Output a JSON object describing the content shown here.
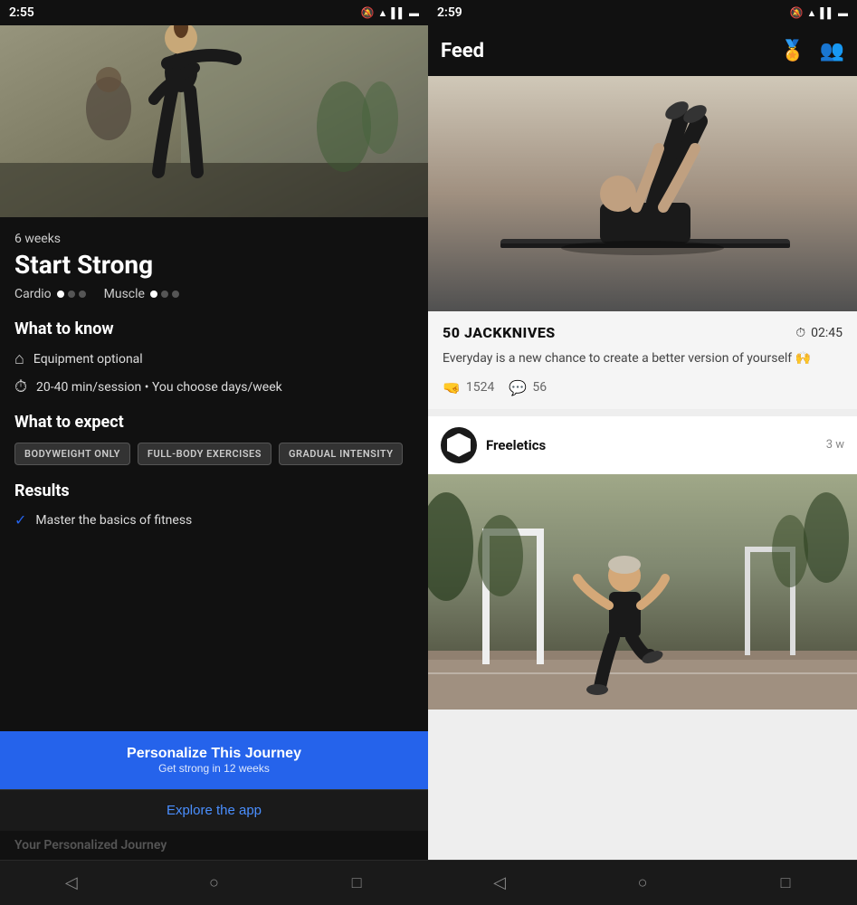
{
  "left": {
    "statusBar": {
      "time": "2:55",
      "icons": [
        "🔔",
        "📶",
        "🔋"
      ]
    },
    "program": {
      "weeks": "6 weeks",
      "title": "Start Strong",
      "cardio": "Cardio",
      "muscle": "Muscle",
      "cardioDots": [
        1,
        0,
        0
      ],
      "muscleDots": [
        1,
        0,
        0
      ]
    },
    "whatToKnow": {
      "sectionTitle": "What to know",
      "equipment": "Equipment optional",
      "duration": "20-40 min/session • You choose days/week"
    },
    "whatToExpect": {
      "sectionTitle": "What to expect",
      "tags": [
        "BODYWEIGHT ONLY",
        "FULL-BODY EXERCISES",
        "GRADUAL INTENSITY"
      ]
    },
    "results": {
      "sectionTitle": "Results",
      "items": [
        "Master the basics of fitness"
      ]
    },
    "buttons": {
      "personalize": "Personalize This Journey",
      "personalizeSubtext": "Get strong in 12 weeks",
      "explore": "Explore the app",
      "ghostText": "Your Personalized Journey"
    },
    "nav": [
      "◁",
      "○",
      "□"
    ]
  },
  "right": {
    "statusBar": {
      "time": "2:59",
      "icons": [
        "🔔",
        "📶",
        "🔋"
      ]
    },
    "header": {
      "title": "Feed",
      "icons": [
        "medal",
        "people"
      ]
    },
    "workoutCard": {
      "name": "50 JACKKNIVES",
      "time": "02:45",
      "description": "Everyday is a new chance to create a better version of yourself 🙌",
      "likes": "1524",
      "comments": "56"
    },
    "post": {
      "username": "Freeletics",
      "timeAgo": "3 w"
    },
    "nav": [
      "◁",
      "○",
      "□"
    ]
  }
}
